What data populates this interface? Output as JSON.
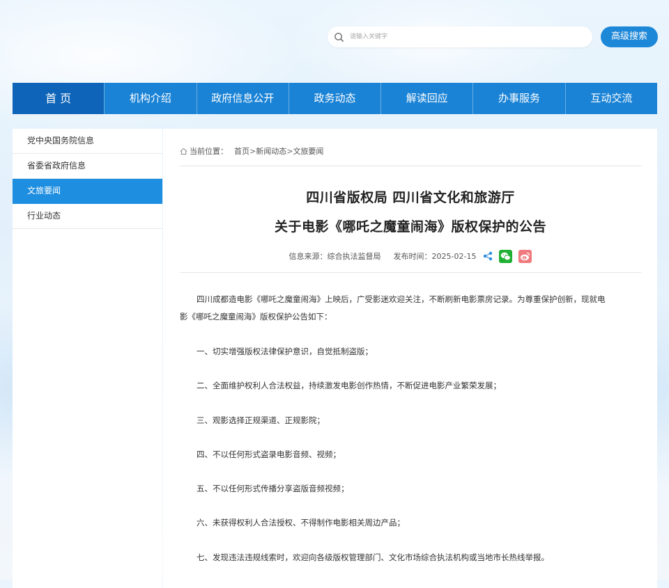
{
  "search": {
    "placeholder": "请输入关键字",
    "advanced_label": "高级搜索"
  },
  "nav": {
    "items": [
      {
        "label": "首 页"
      },
      {
        "label": "机构介绍"
      },
      {
        "label": "政府信息公开"
      },
      {
        "label": "政务动态"
      },
      {
        "label": "解读回应"
      },
      {
        "label": "办事服务"
      },
      {
        "label": "互动交流"
      }
    ]
  },
  "sidebar": {
    "items": [
      {
        "label": "党中央国务院信息"
      },
      {
        "label": "省委省政府信息"
      },
      {
        "label": "文旅要闻"
      },
      {
        "label": "行业动态"
      }
    ],
    "active_index": 2
  },
  "breadcrumb": {
    "prefix": "当前位置：",
    "items": [
      "首页",
      "新闻动态",
      "文旅要闻"
    ],
    "separator": ">"
  },
  "article": {
    "title_line1": "四川省版权局 四川省文化和旅游厅",
    "title_line2": "关于电影《哪吒之魔童闹海》版权保护的公告",
    "source_label": "信息来源：",
    "source": "综合执法监督局",
    "date_label": "发布时间：",
    "date": "2025-02-15",
    "intro_line1": "四川成都造电影《哪吒之魔童闹海》上映后，广受影迷欢迎关注，不断刷新电影票房记录。为尊重保护创新，现就电",
    "intro_line2": "影《哪吒之魔童闹海》版权保护公告如下：",
    "points": [
      "一、切实增强版权法律保护意识，自觉抵制盗版；",
      "二、全面维护权利人合法权益，持续激发电影创作热情，不断促进电影产业繁荣发展；",
      "三、观影选择正规渠道、正规影院；",
      "四、不以任何形式盗录电影音频、视频；",
      "五、不以任何形式传播分享盗版音频视频；",
      "六、未获得权利人合法授权、不得制作电影相关周边产品；",
      "七、发现违法违规线索时，欢迎向各级版权管理部门、文化市场综合执法机构或当地市长热线举报。"
    ]
  },
  "colors": {
    "nav_bg": "#1a83d6",
    "nav_active": "#0e64b8",
    "sidebar_active": "#1d8ee0",
    "wechat": "#1fb034",
    "weibo": "#f07a7e"
  }
}
